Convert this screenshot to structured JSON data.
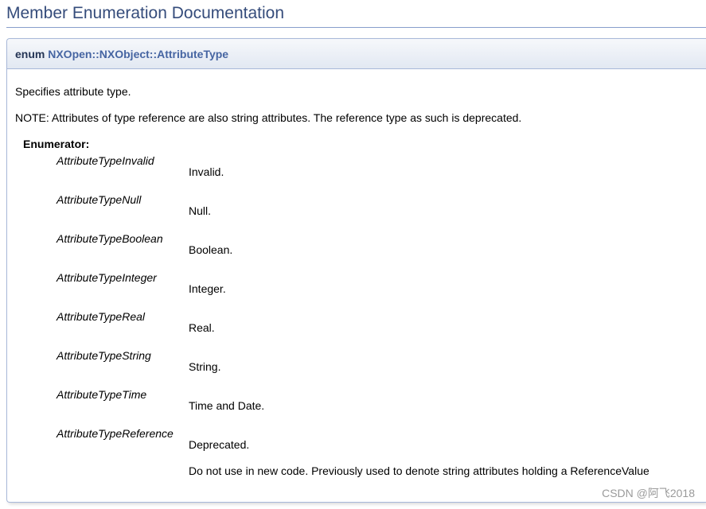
{
  "section_title": "Member Enumeration Documentation",
  "prototype": {
    "keyword": "enum",
    "name": "NXOpen::NXObject::AttributeType"
  },
  "description": "Specifies attribute type.",
  "note": "NOTE: Attributes of type reference are also string attributes. The reference type as such is deprecated.",
  "enumerator_label": "Enumerator:",
  "enumerators": [
    {
      "name": "AttributeTypeInvalid",
      "desc": "Invalid."
    },
    {
      "name": "AttributeTypeNull",
      "desc": "Null."
    },
    {
      "name": "AttributeTypeBoolean",
      "desc": "Boolean."
    },
    {
      "name": "AttributeTypeInteger",
      "desc": "Integer."
    },
    {
      "name": "AttributeTypeReal",
      "desc": "Real."
    },
    {
      "name": "AttributeTypeString",
      "desc": "String."
    },
    {
      "name": "AttributeTypeTime",
      "desc": "Time and Date."
    },
    {
      "name": "AttributeTypeReference",
      "desc": "Deprecated.",
      "extra": "Do not use in new code. Previously used to denote string attributes holding a ReferenceValue"
    }
  ],
  "watermark": "CSDN @阿飞2018"
}
